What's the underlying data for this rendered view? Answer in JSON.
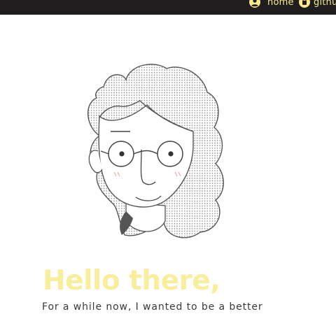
{
  "nav": {
    "home_label": "home",
    "github_label": "github"
  },
  "hero": {
    "title": "Hello there,",
    "text": "For a while now, I wanted to be a better"
  },
  "colors": {
    "topbar_background": "#1f1d1e",
    "nav_accent": "#f7e98c",
    "title_yellow": "#f8ee9c",
    "body_text": "#3a3a3a",
    "hair_stroke": "#6b6b6b",
    "blush": "#f0a7a7"
  },
  "icons": {
    "home": "user-circle-icon",
    "github": "github-icon",
    "portrait": "illustrated-face-portrait"
  }
}
